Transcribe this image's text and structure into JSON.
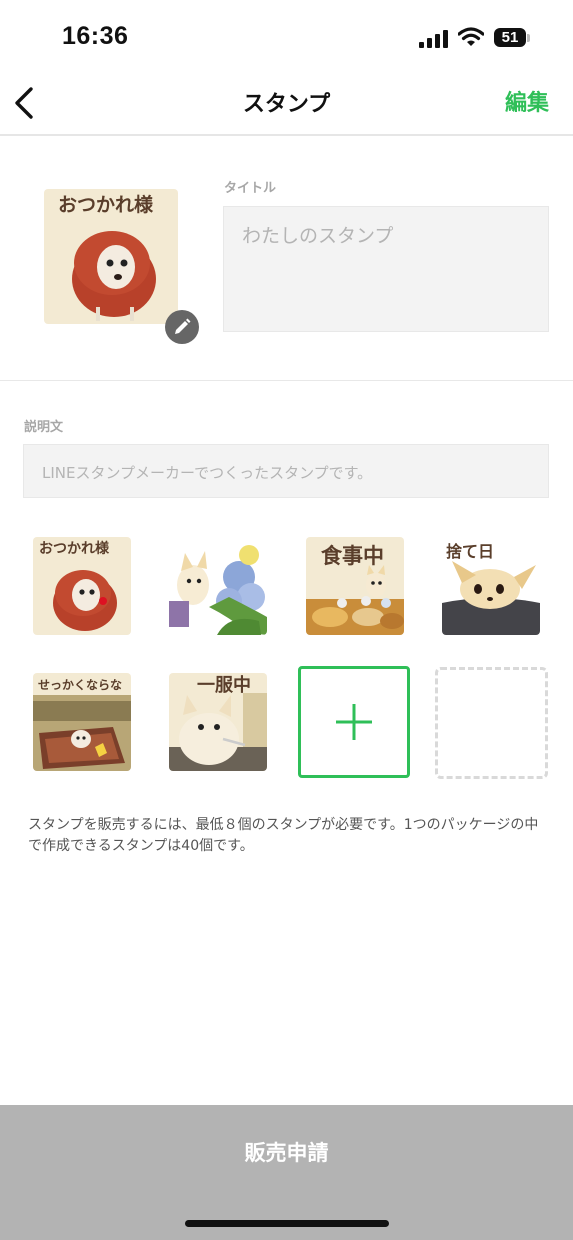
{
  "status_bar": {
    "time": "16:36",
    "battery": "51",
    "icons": [
      "signal-icon",
      "wifi-icon",
      "battery-icon"
    ]
  },
  "nav": {
    "title": "スタンプ",
    "edit_label": "編集",
    "back_icon": "chevron-left-icon"
  },
  "main_sticker": {
    "caption": "おつかれ様",
    "edit_icon": "pencil-icon"
  },
  "title_field": {
    "label": "タイトル",
    "placeholder": "わたしのスタンプ"
  },
  "description_field": {
    "label": "説明文",
    "placeholder": "LINEスタンプメーカーでつくったスタンプです。"
  },
  "stickers": [
    {
      "caption": "おつかれ様"
    },
    {
      "caption": ""
    },
    {
      "caption": "食事中"
    },
    {
      "caption": "捨て日"
    },
    {
      "caption": "せっかくならな"
    },
    {
      "caption": "一服中"
    }
  ],
  "add_slot": {
    "icon": "plus-icon"
  },
  "note": "スタンプを販売するには、最低８個のスタンプが必要です。1つのパッケージの中で作成できるスタンプは40個です。",
  "footer": {
    "label": "販売申請"
  },
  "colors": {
    "accent": "#2fbf58",
    "footer_bg": "#b3b3b3",
    "field_bg": "#f3f3f3"
  }
}
